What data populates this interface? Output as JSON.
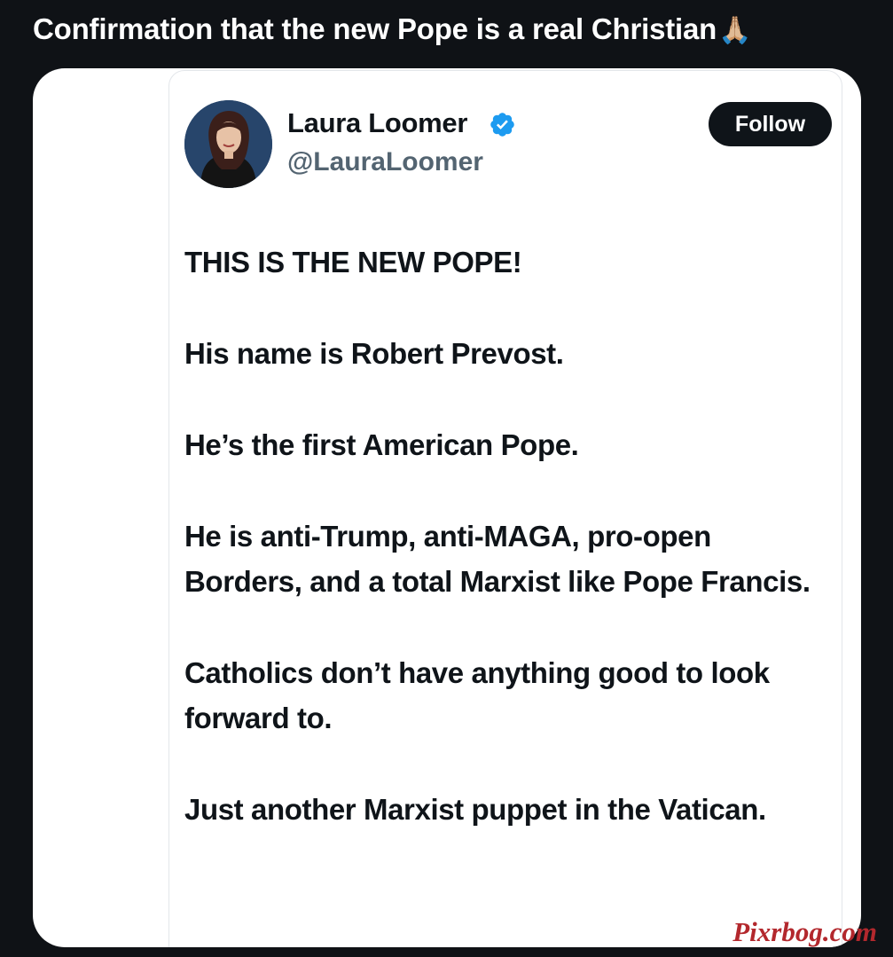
{
  "caption": {
    "text": "Confirmation that the new Pope is a real Christian",
    "emoji": "🙏🏼"
  },
  "tweet": {
    "author_name": "Laura Loomer",
    "handle": "@LauraLoomer",
    "verified": true,
    "follow_label": "Follow",
    "paragraphs": [
      "THIS IS THE NEW POPE!",
      "His name is Robert Prevost.",
      "He’s the first American Pope.",
      "He is anti-Trump, anti-MAGA, pro-open Borders, and a total Marxist like Pope Francis.",
      "Catholics don’t have anything good to look forward to.",
      "Just another Marxist puppet in the Vatican."
    ]
  },
  "watermark": "Pixrbog.com",
  "colors": {
    "page_background": "#0f1216",
    "card_background": "#ffffff",
    "text_primary": "#0f1419",
    "text_secondary": "#536471",
    "verified_blue": "#1d9bf0",
    "watermark_red": "#b3282d"
  },
  "icons": {
    "verified": "verified-badge-icon",
    "avatar": "profile-photo"
  }
}
